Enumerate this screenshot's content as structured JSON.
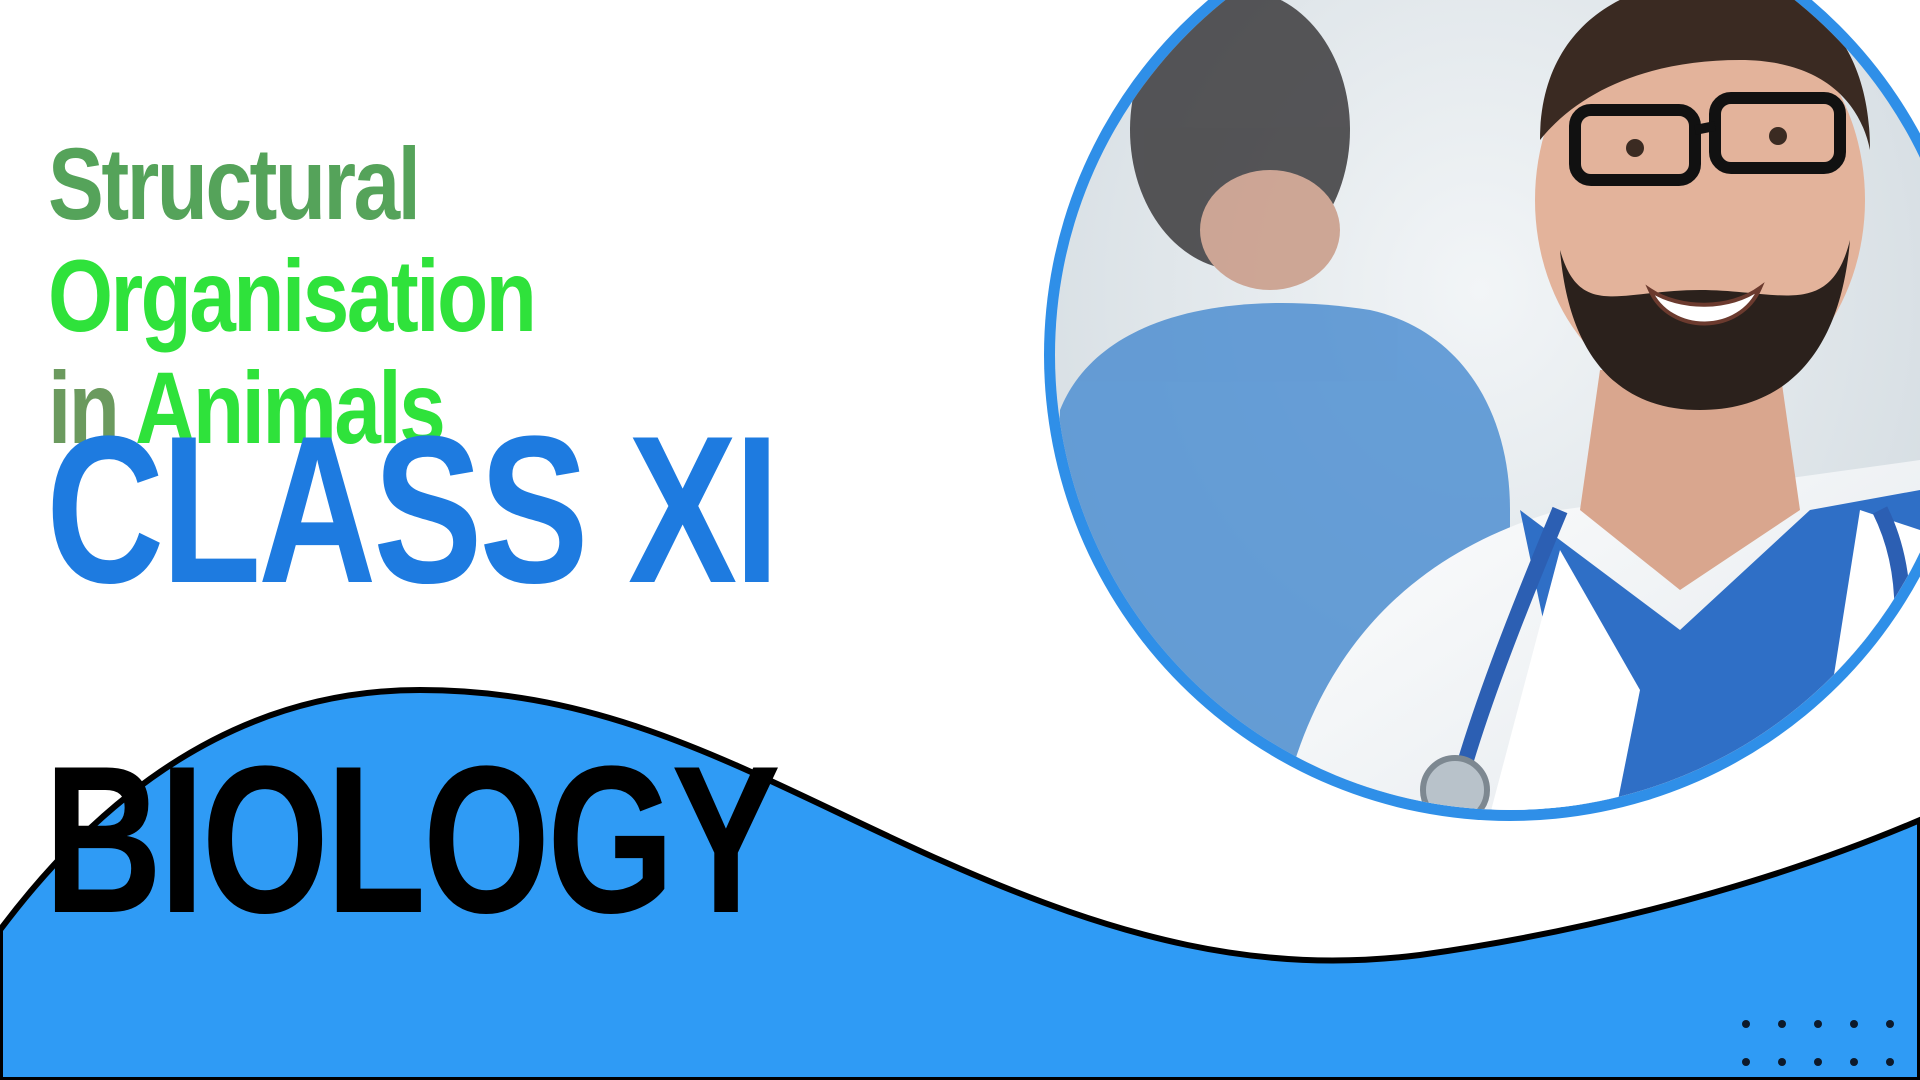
{
  "title": {
    "words": [
      {
        "text": "Structural",
        "color": "#55a35a"
      },
      {
        "text": "Organisation",
        "color": "#2fe23b"
      },
      {
        "text": "in",
        "color": "#6b9a5e"
      },
      {
        "text": "Animals",
        "color": "#2fe23b"
      }
    ]
  },
  "class_label": "CLASS XI",
  "subject_label": "BIOLOGY",
  "photo": {
    "icon": "doctor-portrait",
    "ring_color": "#2f8fe8"
  },
  "colors": {
    "wave": "#2f9bf5",
    "wave_outline": "#000000",
    "class_text": "#1e7be0",
    "subject_text": "#000000",
    "dots": "#0d1a2b"
  }
}
